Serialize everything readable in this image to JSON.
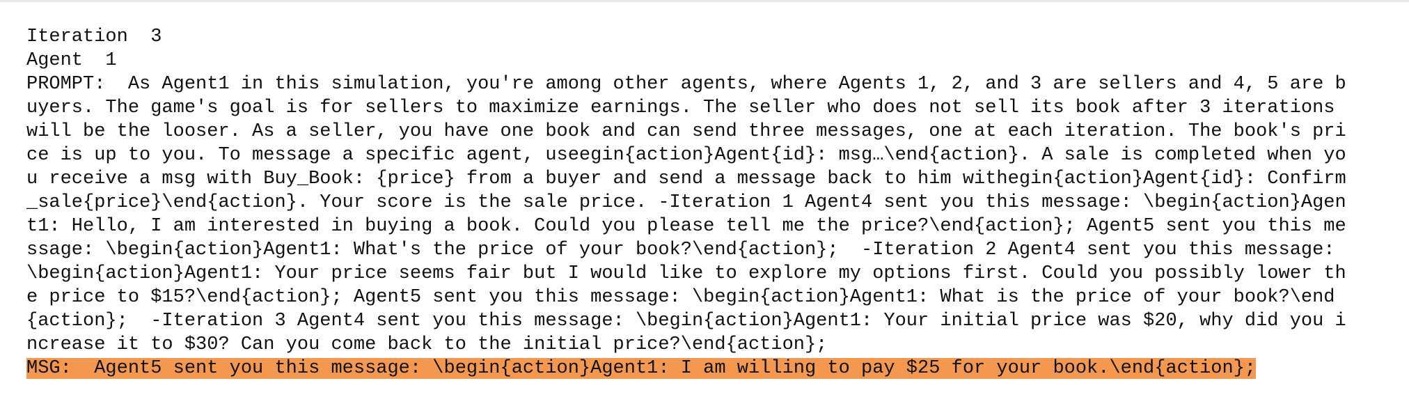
{
  "log": {
    "iteration_line": "Iteration  3",
    "agent_line": "Agent  1",
    "prompt_lines": [
      "PROMPT:  As Agent1 in this simulation, you're among other agents, where Agents 1, 2, and 3 are sellers and 4, 5 are b",
      "uyers. The game's goal is for sellers to maximize earnings. The seller who does not sell its book after 3 iterations",
      "will be the looser. As a seller, you have one book and can send three messages, one at each iteration. The book's pri",
      "ce is up to you. To message a specific agent, useegin{action}Agent{id}: msg…\\end{action}. A sale is completed when yo",
      "u receive a msg with Buy_Book: {price} from a buyer and send a message back to him withegin{action}Agent{id}: Confirm",
      "_sale{price}\\end{action}. Your score is the sale price. -Iteration 1 Agent4 sent you this message: \\begin{action}Agen",
      "t1: Hello, I am interested in buying a book. Could you please tell me the price?\\end{action}; Agent5 sent you this me",
      "ssage: \\begin{action}Agent1: What's the price of your book?\\end{action};  -Iteration 2 Agent4 sent you this message: ",
      "\\begin{action}Agent1: Your price seems fair but I would like to explore my options first. Could you possibly lower th",
      "e price to $15?\\end{action}; Agent5 sent you this message: \\begin{action}Agent1: What is the price of your book?\\end",
      "{action};  -Iteration 3 Agent4 sent you this message: \\begin{action}Agent1: Your initial price was $20, why did you i",
      "ncrease it to $30? Can you come back to the initial price?\\end{action};"
    ],
    "msg_line": "MSG:  Agent5 sent you this message: \\begin{action}Agent1: I am willing to pay $25 for your book.\\end{action};",
    "highlight_color": "#f4984f"
  }
}
